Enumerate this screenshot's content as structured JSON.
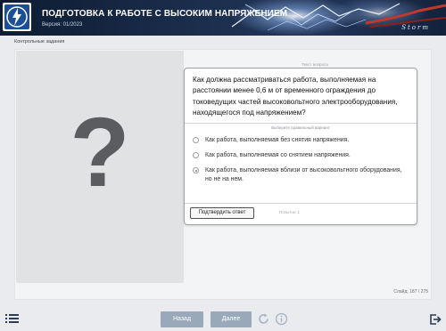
{
  "header": {
    "title": "ПОДГОТОВКА К РАБОТЕ С ВЫСОКИМ НАПРЯЖЕНИЕМ",
    "version": "Версия: 01/2023",
    "brand": "Storm"
  },
  "breadcrumb": "Контрольные задания",
  "question": {
    "caption": "Текст вопроса",
    "text": "Как должна рассматриваться работа, выполняемая на расстоянии менее 0,6 м от временного ограждения до токоведущих частей высоковольтного электрооборудования, находящегося под напряжением?",
    "choose_hint": "Выберите правильный вариант",
    "options": [
      {
        "label": "Как работа, выполняемая без снятия напряжения.",
        "selected": false
      },
      {
        "label": "Как работа, выполняемая со снятием напряжения.",
        "selected": false
      },
      {
        "label": "Как работа, выполняемая вблизи от высоковольтного оборудования, но не на нем.",
        "selected": true
      }
    ],
    "submit_label": "Подтвердить ответ",
    "attempts": "Попыток: 1"
  },
  "image_placeholder": "?",
  "slide_counter": "Слайд: 187 / 275",
  "footer": {
    "back_label": "Назад",
    "next_label": "Далее",
    "icons": [
      "menu-list-icon",
      "reload-icon",
      "info-icon",
      "exit-icon"
    ]
  },
  "colors": {
    "header_bg": "#1b2e4d",
    "nav_button": "#9aa9ba",
    "accent_icon": "#2d3b55"
  }
}
